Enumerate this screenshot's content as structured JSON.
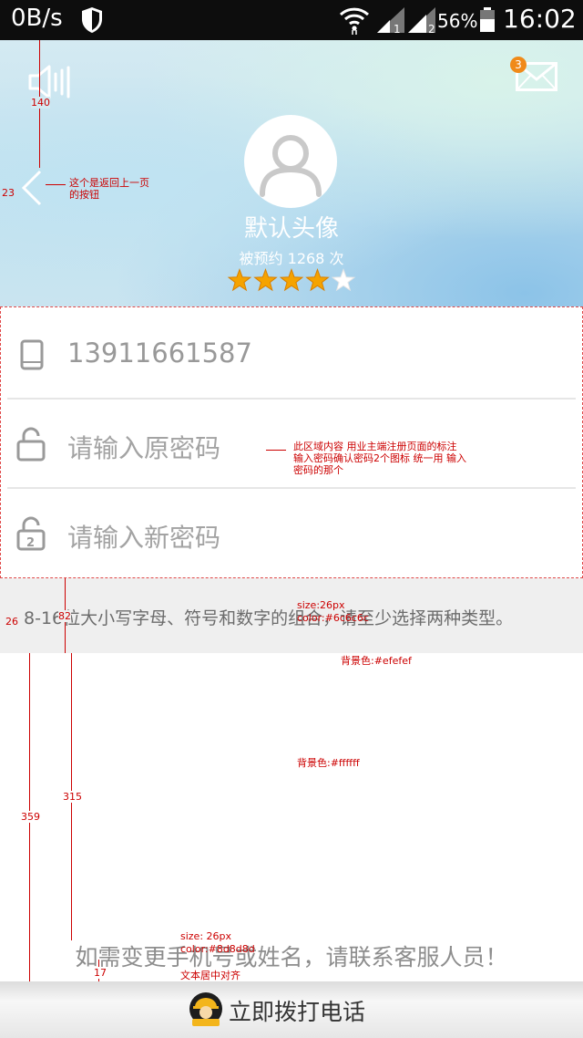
{
  "status_bar": {
    "speed": "0B/s",
    "battery_percent": "56%",
    "time": "16:02",
    "icons": [
      "shield-icon",
      "wifi-icon",
      "signal-1-icon",
      "signal-2-icon",
      "battery-icon"
    ]
  },
  "header": {
    "notification_count": "3",
    "username": "默认头像",
    "booking_count": "被预约 1268 次",
    "rating": 4,
    "rating_max": 5,
    "star_color": "#f5a300",
    "icons": [
      "volume-icon",
      "mail-icon",
      "avatar-icon",
      "back-icon"
    ]
  },
  "form": {
    "phone": "13911661587",
    "old_password_placeholder": "请输入原密码",
    "new_password_placeholder": "请输入新密码",
    "icons": [
      "phone-icon",
      "lock-icon",
      "lock-2-icon"
    ]
  },
  "hint": {
    "text": "8-16位大小写字母、符号和数字的组合，请至少选择两种类型。"
  },
  "notice": {
    "text": "如需变更手机号或姓名，请联系客服人员！"
  },
  "call_button": {
    "label": "立即拨打电话",
    "icons": [
      "worker-icon"
    ]
  },
  "annotations": {
    "m140": "140",
    "m23": "23",
    "back_note": "这个是返回上一页的按钮",
    "region_note": "此区域内容 用业主端注册页面的标注　 输入密码确认密码2个图标 统一用 输入密码的那个",
    "m26": "26",
    "m82": "82",
    "hint_size": "size:26px",
    "hint_color": "color:#6c6c6c",
    "hint_bg": "背景色:#efefef",
    "white_bg": "背景色:#ffffff",
    "m315": "315",
    "m359": "359",
    "notice_size": "size: 26px",
    "notice_color": "color:#8d8d8d",
    "notice_align": "文本居中对齐",
    "m17": "17"
  },
  "colors": {
    "hint_bg": "#efefef",
    "hint_text": "#6c6c6c",
    "page_bg": "#ffffff",
    "notice_text": "#8d8d8d",
    "annotation": "#cc0000"
  }
}
